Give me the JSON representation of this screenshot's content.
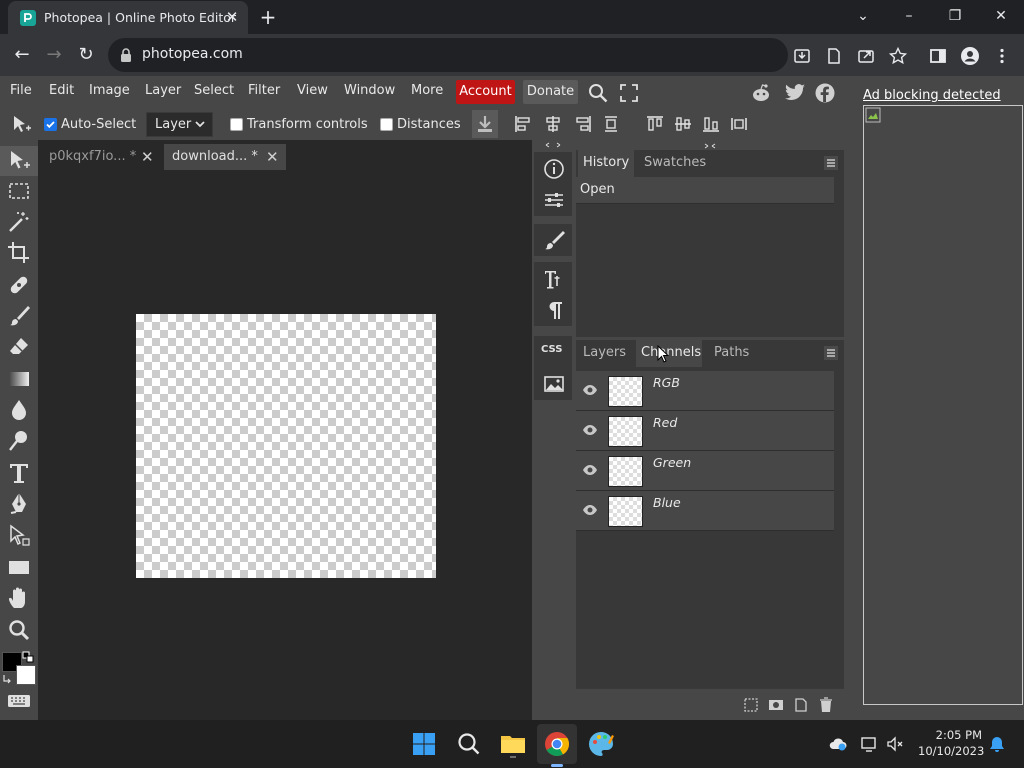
{
  "browser": {
    "tab_title": "Photopea | Online Photo Editor",
    "url": "photopea.com"
  },
  "menubar": {
    "items": [
      "File",
      "Edit",
      "Image",
      "Layer",
      "Select",
      "Filter",
      "View",
      "Window",
      "More"
    ],
    "account": "Account",
    "donate": "Donate"
  },
  "options": {
    "auto_select_label": "Auto-Select",
    "auto_select_checked": true,
    "layer_select_value": "Layer",
    "transform_controls_label": "Transform controls",
    "transform_controls_checked": false,
    "distances_label": "Distances",
    "distances_checked": false
  },
  "documents": {
    "tabs": [
      {
        "label": "p0kqxf7io...  *",
        "active": false
      },
      {
        "label": "download...  *",
        "active": true
      }
    ]
  },
  "history_panel": {
    "tabs": [
      "History",
      "Swatches"
    ],
    "rows": [
      "Open"
    ]
  },
  "layers_panel": {
    "tabs": [
      "Layers",
      "Channels",
      "Paths"
    ],
    "active_tab": "Channels",
    "channels": [
      "RGB",
      "Red",
      "Green",
      "Blue"
    ]
  },
  "ad": {
    "link_text": "Ad blocking detected"
  },
  "taskbar": {
    "time": "2:05 PM",
    "date": "10/10/2023"
  },
  "colors": {
    "account_bg": "#c01515",
    "panel_bg": "#474747",
    "canvas_bg": "#282828"
  }
}
